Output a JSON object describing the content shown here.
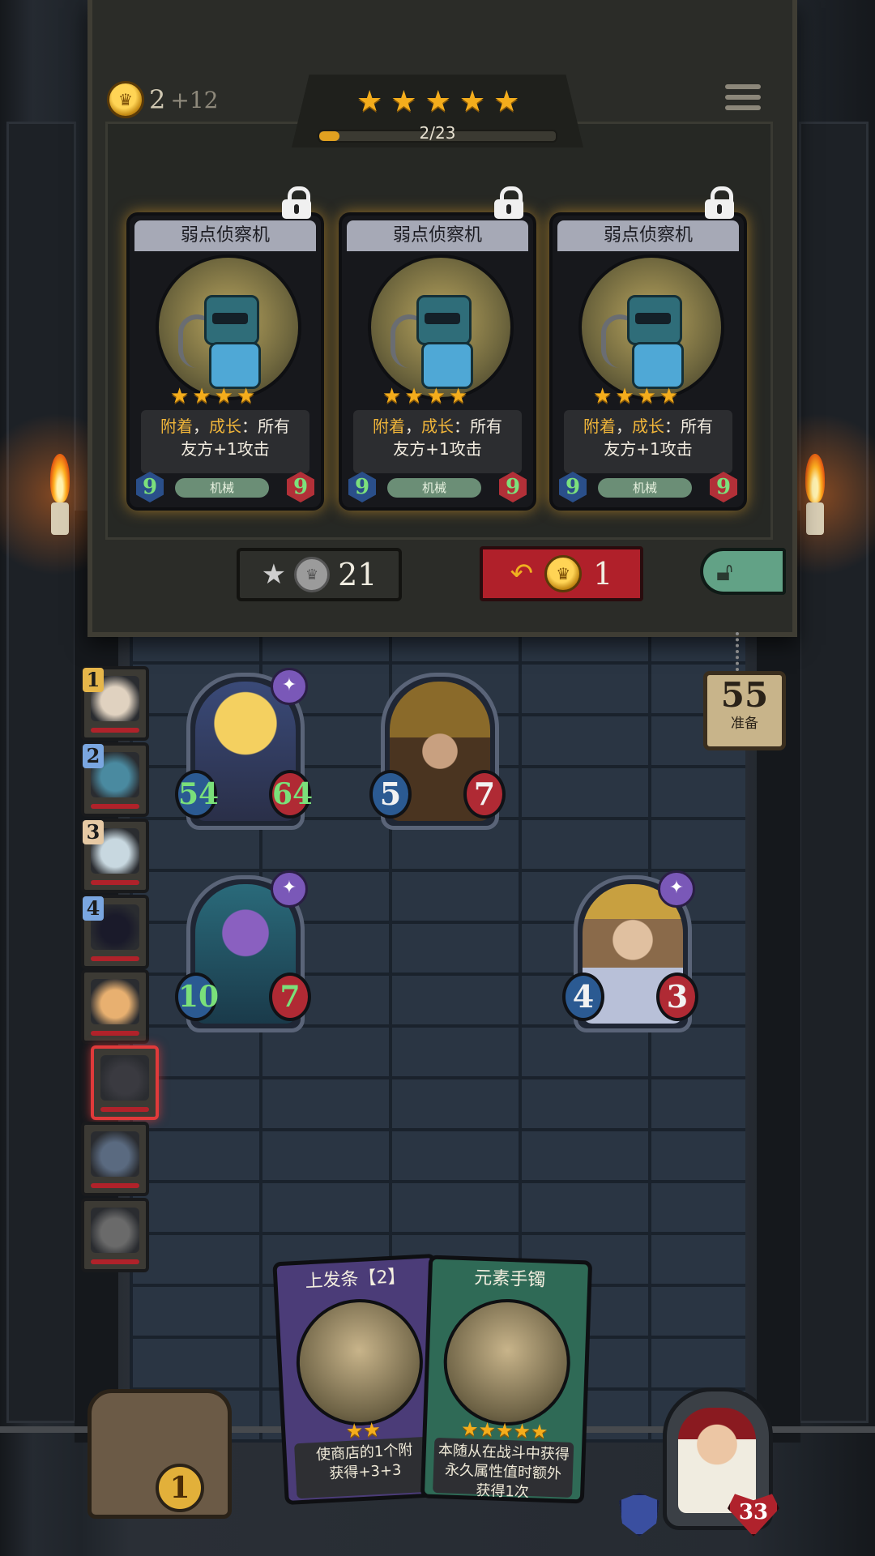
{
  "hud": {
    "gold": "2",
    "gold_income": "+12",
    "tavern_stars": 5,
    "progress_text": "2/23",
    "progress_fraction": 0.087
  },
  "shop": {
    "cards": [
      {
        "name": "弱点侦察机",
        "stars": 4,
        "kw1": "附着",
        "sep": "，",
        "kw2": "成长",
        "desc_rest": "：所有",
        "desc_line2": "友方+1攻击",
        "tag": "机械",
        "attack": "9",
        "health": "9",
        "locked": true
      },
      {
        "name": "弱点侦察机",
        "stars": 4,
        "kw1": "附着",
        "sep": "，",
        "kw2": "成长",
        "desc_rest": "：所有",
        "desc_line2": "友方+1攻击",
        "tag": "机械",
        "attack": "9",
        "health": "9",
        "locked": true
      },
      {
        "name": "弱点侦察机",
        "stars": 4,
        "kw1": "附着",
        "sep": "，",
        "kw2": "成长",
        "desc_rest": "：所有",
        "desc_line2": "友方+1攻击",
        "tag": "机械",
        "attack": "9",
        "health": "9",
        "locked": true
      }
    ],
    "upgrade_cost": "21",
    "refresh_cost": "1"
  },
  "team": [
    {
      "num": "1",
      "color": "#e6b64a"
    },
    {
      "num": "2",
      "color": "#7aa6e0"
    },
    {
      "num": "3",
      "color": "#e6c9a4"
    },
    {
      "num": "4",
      "color": "#7aa6e0"
    },
    {
      "num": "",
      "color": ""
    },
    {
      "num": "",
      "color": ""
    },
    {
      "num": "",
      "color": ""
    },
    {
      "num": "",
      "color": ""
    }
  ],
  "board": {
    "minions": [
      {
        "attack": "54",
        "health": "64",
        "big": true
      },
      {
        "attack": "5",
        "health": "7",
        "big": false
      },
      {
        "attack": "10",
        "health": "7",
        "big": true
      },
      {
        "attack": "4",
        "health": "3",
        "big": false
      }
    ]
  },
  "ready": {
    "count": "55",
    "label": "准备"
  },
  "hand": [
    {
      "title": "上发条【2】",
      "stars": 2,
      "desc": "使商店的1个附\n获得+3+3"
    },
    {
      "title": "元素手镯",
      "stars": 5,
      "desc": "本随从在战斗中获得\n永久属性值时额外\n获得1次"
    }
  ],
  "chest_count": "1",
  "hero_health": "33",
  "colors": {
    "gold": "#f4ad1c",
    "refresh_red": "#b0202a",
    "unlock_green": "#62a286"
  }
}
